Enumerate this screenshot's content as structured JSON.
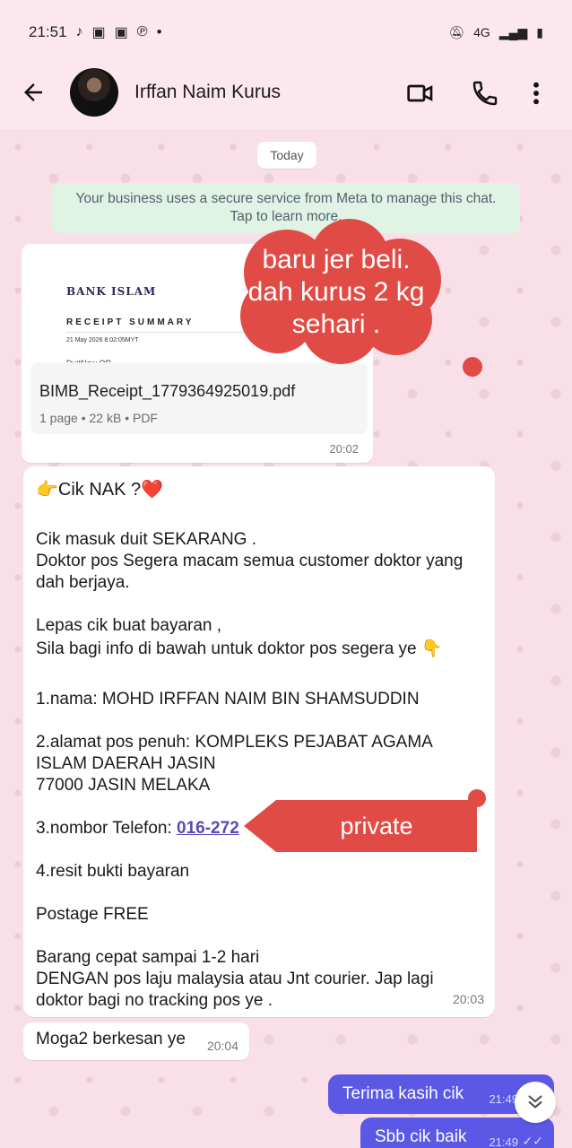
{
  "status_bar": {
    "time": "21:51",
    "left_icons": [
      "tiktok-icon",
      "facebook-icon",
      "facebook-icon",
      "pinterest-icon"
    ],
    "dot": "•",
    "network": "4G"
  },
  "header": {
    "contact_name": "Irffan Naim Kurus"
  },
  "chat": {
    "date_chip": "Today",
    "meta_notice_line1": "Your business uses a secure service from Meta to manage this chat.",
    "meta_notice_line2": "Tap to learn more.",
    "document": {
      "thumb_bank": "BANK ISLAM",
      "thumb_title": "RECEIPT SUMMARY",
      "thumb_date": "21 May 2026 8:02:05MYT",
      "thumb_duit": "DuitNow QR",
      "filename": "BIMB_Receipt_1779364925019.pdf",
      "meta": "1 page • 22 kB • PDF",
      "time": "20:02"
    },
    "overlay_cloud_text": "baru jer beli. dah kurus 2 kg sehari .",
    "overlay_private_text": "private",
    "message": {
      "greeting": "👉Cik NAK ?❤️",
      "lines": [
        " Cik masuk duit  SEKARANG .",
        " Doktor pos   Segera macam semua customer doktor yang",
        "dah berjaya.",
        "Lepas cik buat bayaran ,",
        "Sila bagi info di bawah untuk doktor pos segera ye 👇",
        "1.nama: MOHD IRFFAN NAIM BIN SHAMSUDDIN",
        "2.alamat pos penuh: KOMPLEKS PEJABAT AGAMA",
        "ISLAM DAERAH JASIN",
        "77000 JASIN MELAKA",
        "3.nombor Telefon: ",
        "4.resit bukti  bayaran",
        "Postage FREE",
        "Barang cepat sampai 1-2 hari",
        "DENGAN pos laju malaysia atau Jnt courier. Jap lagi",
        "doktor bagi no tracking pos ye ."
      ],
      "phone_partial": "016-272",
      "time": "20:03"
    },
    "short_message": {
      "text": "Moga2 berkesan ye",
      "time": "20:04"
    },
    "outgoing": [
      {
        "text": "Terima kasih cik",
        "time": "21:49"
      },
      {
        "text": "Sbb cik baik",
        "time": "21:49"
      }
    ]
  },
  "colors": {
    "outgoing_bubble": "#5b58e6",
    "overlay_red": "#e14b45",
    "notice_bg": "#dff4e4"
  }
}
